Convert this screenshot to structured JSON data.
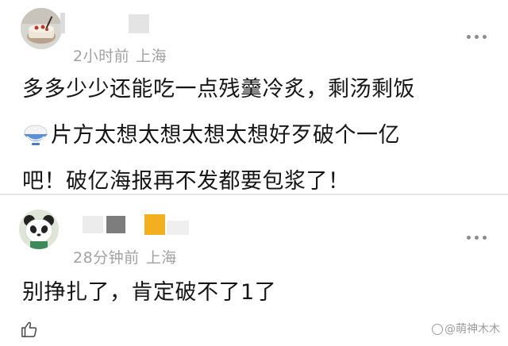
{
  "comments": [
    {
      "time": "2小时前",
      "location": "上海",
      "avatar_icon": "cake-food-avatar",
      "line1": "多多少少还能吃一点残羹冷炙，剩汤剩饭",
      "emoji": "rice-bowl-emoji",
      "line2": "片方太想太想太想太想好歹破个一亿",
      "line3": "吧！破亿海报再不发都要包浆了！"
    },
    {
      "time": "28分钟前",
      "location": "上海",
      "avatar_icon": "panda-avatar",
      "line1": "别挣扎了，肯定破不了1了"
    }
  ],
  "actions": {
    "more_icon": "more-dots-icon",
    "like_icon": "thumbs-up-icon"
  },
  "watermark": {
    "text": "@萌神木木"
  },
  "colors": {
    "meta_text": "#a2a2a2",
    "body_text": "#151515",
    "divider": "#e6e6e6"
  }
}
